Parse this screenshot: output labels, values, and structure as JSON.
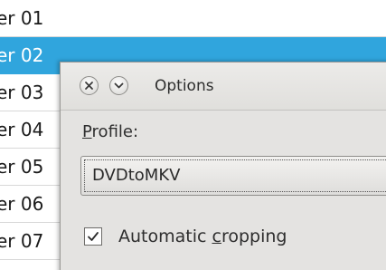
{
  "list": {
    "rows": [
      {
        "text": "er 01",
        "selected": false
      },
      {
        "text": "er 02",
        "selected": true
      },
      {
        "text": "er 03",
        "selected": false
      },
      {
        "text": "er 04",
        "selected": false
      },
      {
        "text": "er 05",
        "selected": false
      },
      {
        "text": "er 06",
        "selected": false
      },
      {
        "text": "er 07",
        "selected": false
      }
    ]
  },
  "dialog": {
    "title": "Options",
    "buttons": {
      "close_icon": "close-icon",
      "minimize_icon": "chevron-down-icon"
    },
    "profile_label": {
      "accel": "P",
      "rest": "rofile:"
    },
    "profile_value": "DVDtoMKV",
    "auto_crop": {
      "checked": true,
      "label_before": "Automatic ",
      "label_accel": "c",
      "label_after": "ropping"
    }
  },
  "colors": {
    "selection": "#30a5dd",
    "dialog_bg": "#e4e3e1"
  }
}
